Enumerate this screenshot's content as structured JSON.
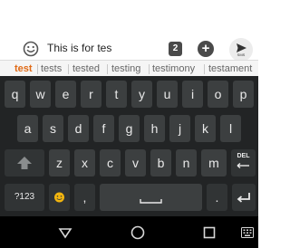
{
  "compose": {
    "text": "This is for tes",
    "count_badge": "2",
    "add_label": "+",
    "send_label": "SMS"
  },
  "suggestions": [
    "test",
    "tests",
    "tested",
    "testing",
    "testimony",
    "testament"
  ],
  "keyboard": {
    "row1": [
      "q",
      "w",
      "e",
      "r",
      "t",
      "y",
      "u",
      "i",
      "o",
      "p"
    ],
    "row2": [
      "a",
      "s",
      "d",
      "f",
      "g",
      "h",
      "j",
      "k",
      "l"
    ],
    "row3": [
      "z",
      "x",
      "c",
      "v",
      "b",
      "n",
      "m"
    ],
    "delete_label": "DEL",
    "symbols_label": "?123",
    "comma_label": ",",
    "period_label": "."
  },
  "colors": {
    "keyboard_bg": "#222425",
    "key_bg": "#3c3f40",
    "suggestion_selected": "#e06a16",
    "emoji_key": "#f2b50f"
  }
}
